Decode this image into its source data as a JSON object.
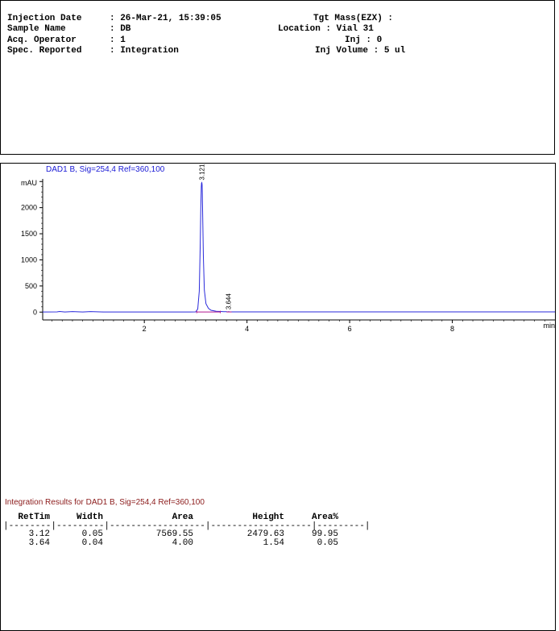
{
  "header": {
    "injection_date_label": "Injection Date",
    "injection_date_value": ": 26-Mar-21, 15:39:05",
    "sample_name_label": "Sample Name",
    "sample_name_value": ": DB",
    "acq_operator_label": "Acq. Operator",
    "acq_operator_value": ": 1",
    "spec_reported_label": "Spec. Reported",
    "spec_reported_value": ": Integration",
    "tgt_mass": "Tgt Mass(EZX) :",
    "location": "Location : Vial 31",
    "inj": "Inj : 0",
    "inj_volume": "Inj Volume : 5 ul"
  },
  "chart_data": {
    "type": "line",
    "title": "DAD1 B, Sig=254,4 Ref=360,100",
    "ylabel": "mAU",
    "xlabel": "min",
    "xlim": [
      0.02,
      10.0
    ],
    "ylim": [
      -150,
      2550
    ],
    "x_ticks": [
      2,
      4,
      6,
      8
    ],
    "y_ticks": [
      0,
      500,
      1000,
      1500,
      2000
    ],
    "grid": false,
    "colors": {
      "trace": "#2a2adb",
      "integration": "#b0188f",
      "title": "#1a1ad6"
    },
    "series": [
      {
        "x": [
          0.02,
          0.3,
          0.35,
          0.45,
          0.6,
          0.8,
          0.95,
          1.2,
          2.0,
          2.9,
          3.0,
          3.04,
          3.07,
          3.09,
          3.1,
          3.11,
          3.115,
          3.12,
          3.125,
          3.13,
          3.14,
          3.15,
          3.17,
          3.2,
          3.25,
          3.3,
          3.4,
          3.55,
          3.6,
          3.62,
          3.64,
          3.66,
          3.68,
          3.72,
          4.0,
          6.0,
          8.0,
          10.0
        ],
        "y": [
          2,
          4,
          12,
          3,
          10,
          2,
          10,
          3,
          3,
          3,
          5,
          60,
          400,
          1300,
          2000,
          2400,
          2470,
          2479.63,
          2440,
          2250,
          1700,
          1050,
          420,
          160,
          70,
          35,
          15,
          8,
          7,
          4,
          9,
          6,
          5,
          4,
          4,
          4,
          4,
          4
        ]
      }
    ],
    "peaks": [
      {
        "label": "3.121",
        "rt": 3.12,
        "height": 2479.63
      },
      {
        "label": "3.644",
        "rt": 3.64,
        "height": 1.54
      }
    ]
  },
  "results": {
    "title": "Integration Results for DAD1 B, Sig=254,4 Ref=360,100",
    "columns": [
      "RetTim",
      "Width",
      "Area",
      "Height",
      "Area%"
    ],
    "separator": "|--------|---------|------------------|-------------------|---------|",
    "rows": [
      [
        "3.12",
        "0.05",
        "7569.55",
        "2479.63",
        "99.95"
      ],
      [
        "3.64",
        "0.04",
        "4.00",
        "1.54",
        "0.05"
      ]
    ]
  }
}
